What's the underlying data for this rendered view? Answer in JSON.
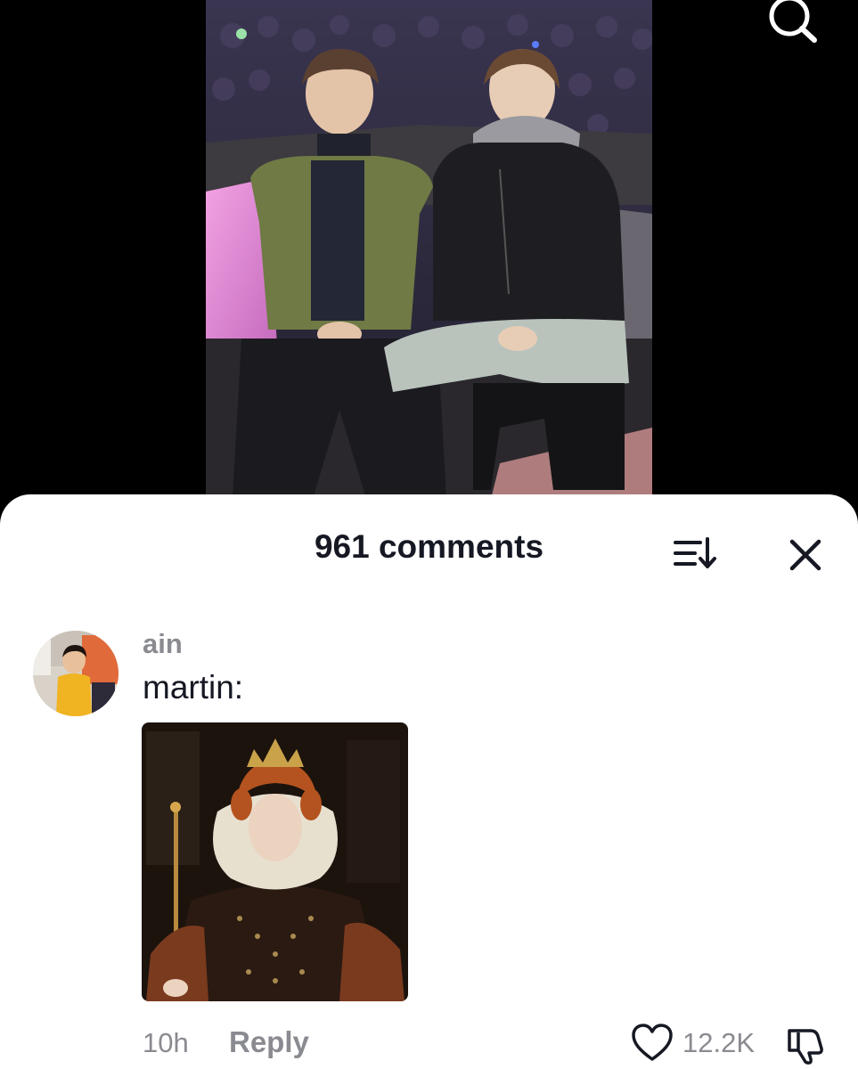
{
  "header": {
    "search_icon": "search-icon"
  },
  "video": {
    "description_icon": "video-thumbnail"
  },
  "comments_sheet": {
    "title": "961 comments",
    "sort_icon": "sort-icon",
    "close_icon": "close-icon"
  },
  "comment": {
    "username": "ain",
    "text": "martin:",
    "time": "10h",
    "reply_label": "Reply",
    "like_count": "12.2K",
    "like_icon": "heart-icon",
    "dislike_icon": "thumbs-down-icon"
  },
  "colors": {
    "text_primary": "#161823",
    "text_secondary": "#8a8b91",
    "sheet_bg": "#ffffff",
    "page_bg": "#000000"
  }
}
